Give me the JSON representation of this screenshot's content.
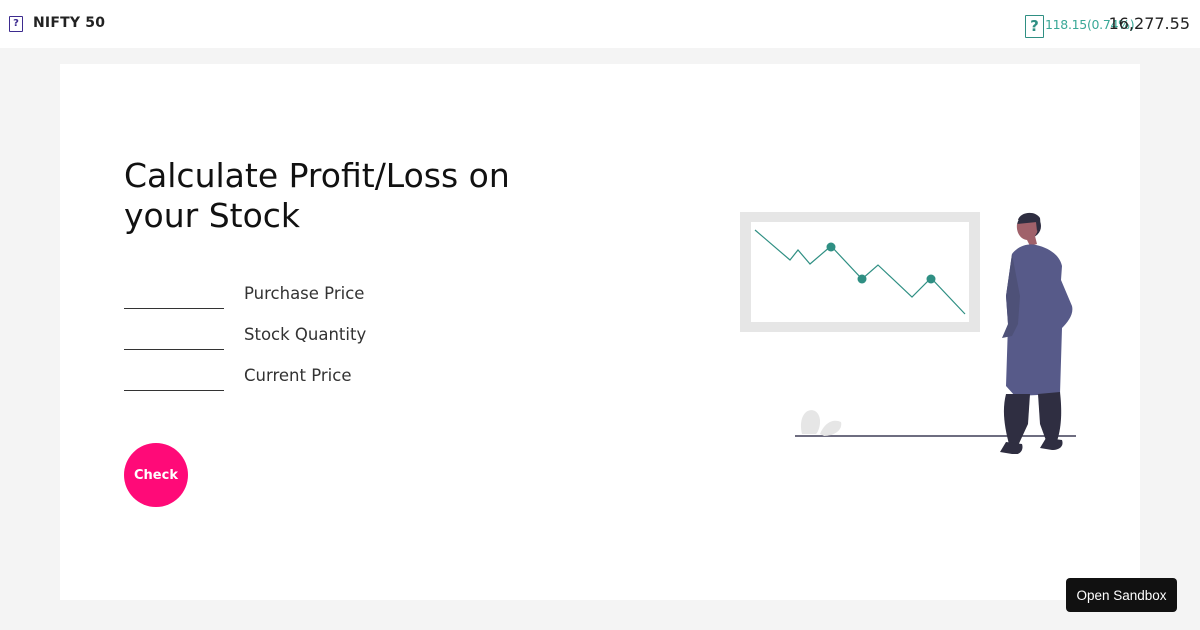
{
  "header": {
    "brand_icon": "broken-image-icon",
    "index_name": "NIFTY 50",
    "change_icon": "broken-image-icon",
    "change_text": "118.15(0.74%)",
    "index_value": "16,277.55",
    "change_color": "#3aa897"
  },
  "main": {
    "title": "Calculate Profit/Loss on your Stock",
    "fields": [
      {
        "label": "Purchase Price",
        "value": ""
      },
      {
        "label": "Stock Quantity",
        "value": ""
      },
      {
        "label": "Current Price",
        "value": ""
      }
    ],
    "check_label": "Check",
    "accent_color": "#ff0a78",
    "illustration": "person-looking-at-declining-chart"
  },
  "sandbox": {
    "label": "Open Sandbox"
  }
}
